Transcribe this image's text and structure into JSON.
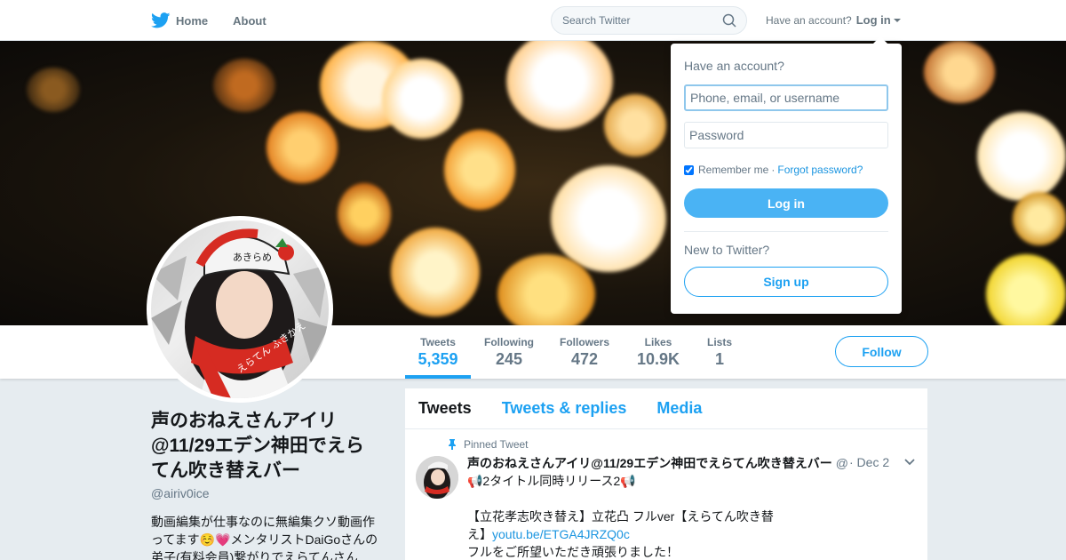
{
  "nav": {
    "home_label": "Home",
    "about_label": "About",
    "search_placeholder": "Search Twitter",
    "have_account": "Have an account?",
    "login_label": "Log in"
  },
  "colors": {
    "accent": "#1da1f2",
    "link": "#1b95e0",
    "muted": "#657786",
    "login_button": "#4ab3f4"
  },
  "stats": [
    {
      "label": "Tweets",
      "value": "5,359"
    },
    {
      "label": "Following",
      "value": "245"
    },
    {
      "label": "Followers",
      "value": "472"
    },
    {
      "label": "Likes",
      "value": "10.9K"
    },
    {
      "label": "Lists",
      "value": "1"
    }
  ],
  "follow_label": "Follow",
  "profile": {
    "name": "声のおねえさんアイリ@11/29エデン神田でえらてん吹き替えバー",
    "handle": "@airiv0ice",
    "bio": "動画編集が仕事なのに無編集クソ動画作ってます☺️💗メンタリストDaiGoさんの弟子(有料会員)繋がりでえらてんさん"
  },
  "timeline": {
    "tabs": [
      "Tweets",
      "Tweets & replies",
      "Media"
    ]
  },
  "tweet": {
    "pinned_label": "Pinned Tweet",
    "name": "声のおねえさんアイリ@11/29エデン神田でえらてん吹き替えバー",
    "handle_fragment": "@",
    "date": "· Dec 2",
    "line1": "📢2タイトル同時リリース2📢",
    "line2": "【立花孝志吹き替え】立花凸 フルver【えらてん吹き替",
    "line3_prefix": "え】",
    "link": "youtu.be/ETGA4JRZQ0c",
    "line4": "フルをご所望いただき頑張りました！"
  },
  "login_dropdown": {
    "title": "Have an account?",
    "username_placeholder": "Phone, email, or username",
    "password_placeholder": "Password",
    "remember_label": "Remember me",
    "separator": "·",
    "forgot_label": "Forgot password?",
    "login_button": "Log in",
    "new_label": "New to Twitter?",
    "signup_button": "Sign up"
  },
  "avatar_hat_text": "あきらめ",
  "avatar_scarf_text": "えらてん ふきかえ"
}
